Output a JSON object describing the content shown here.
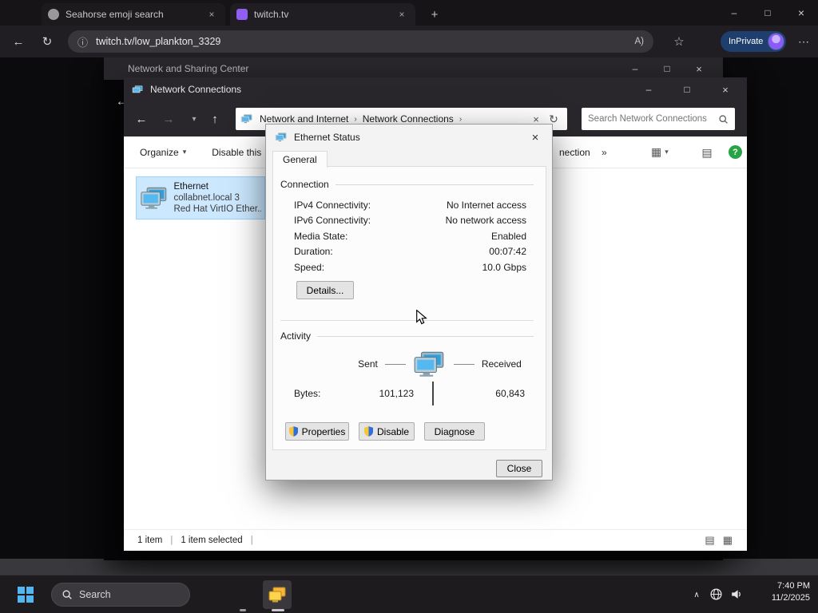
{
  "browser": {
    "tab1": "Seahorse emoji search",
    "tab2": "twitch.tv",
    "url": "twitch.tv/low_plankton_3329",
    "inprivate_label": "InPrivate"
  },
  "nsc": {
    "title": "Network and Sharing Center"
  },
  "nc": {
    "title": "Network Connections",
    "crumb1": "Network and Internet",
    "crumb2": "Network Connections",
    "search_placeholder": "Search Network Connections",
    "organize": "Organize",
    "disable_this": "Disable this",
    "right_cmd": "nection",
    "item": {
      "name": "Ethernet",
      "domain": "collabnet.local 3",
      "device": "Red Hat VirtIO Ether..."
    },
    "status": {
      "count": "1 item",
      "selected": "1 item selected"
    }
  },
  "dialog": {
    "title": "Ethernet Status",
    "tab_general": "General",
    "connection": {
      "label": "Connection",
      "rows": [
        {
          "label": "IPv4 Connectivity:",
          "value": "No Internet access"
        },
        {
          "label": "IPv6 Connectivity:",
          "value": "No network access"
        },
        {
          "label": "Media State:",
          "value": "Enabled"
        },
        {
          "label": "Duration:",
          "value": "00:07:42"
        },
        {
          "label": "Speed:",
          "value": "10.0 Gbps"
        }
      ]
    },
    "details_button": "Details...",
    "activity": {
      "label": "Activity",
      "sent": "Sent",
      "received": "Received",
      "bytes_label": "Bytes:",
      "sent_bytes": "101,123",
      "received_bytes": "60,843"
    },
    "properties_button": "Properties",
    "disable_button": "Disable",
    "diagnose_button": "Diagnose",
    "close_button": "Close"
  },
  "taskbar": {
    "search_placeholder": "Search",
    "time": "7:40 PM",
    "date": "11/2/2025"
  },
  "icons": {
    "back_arrow": "←",
    "forward_arrow": "→",
    "up_arrow": "↑",
    "dropdown": "▾",
    "refresh": "↻",
    "close": "×",
    "minimize": "–",
    "maximize": "□",
    "breadcrumb_chevron": "›",
    "double_chevron": "»",
    "star": "☆",
    "more": "⋯",
    "info": "ⓘ",
    "new_tab": "+",
    "tray_chevron": "∧",
    "pipe": "|",
    "view_tiles": "▦",
    "view_list": "▤",
    "help": "?",
    "read_aloud": "A)"
  }
}
